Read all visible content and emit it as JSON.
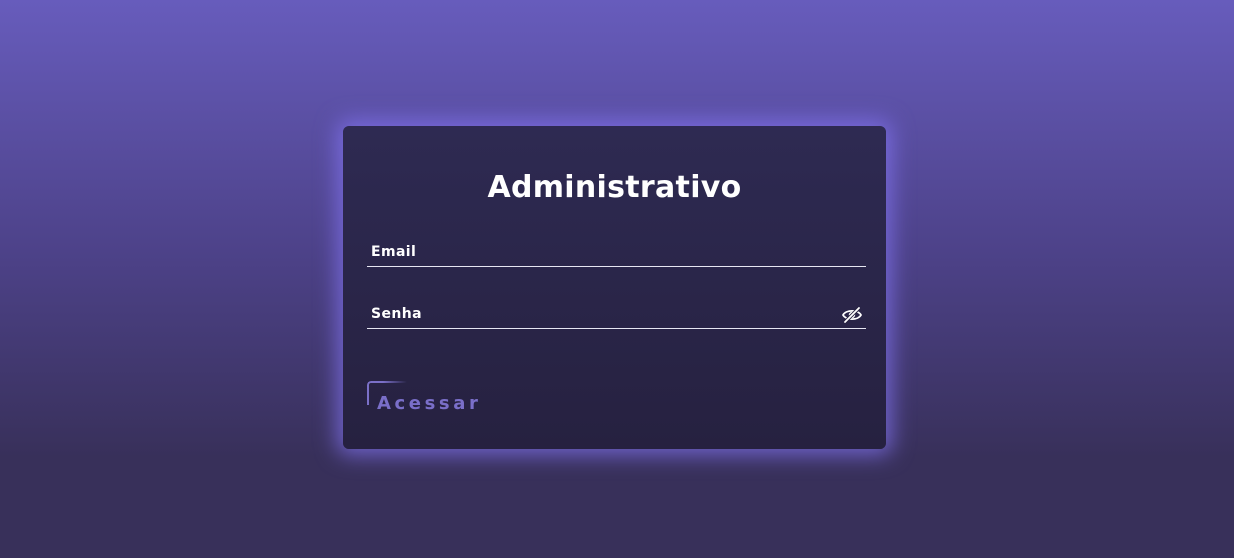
{
  "login": {
    "title": "Administrativo",
    "email": {
      "label": "Email",
      "value": ""
    },
    "senha": {
      "label": "Senha",
      "value": ""
    },
    "submit_label": "Acessar"
  },
  "icons": {
    "password_toggle": "eye-slash-icon"
  },
  "colors": {
    "background_top": "#675cbc",
    "background_bottom": "#38305a",
    "card": "#2a2548",
    "glow": "#8273f0",
    "accent": "#7a6fc9",
    "text": "#ffffff"
  }
}
